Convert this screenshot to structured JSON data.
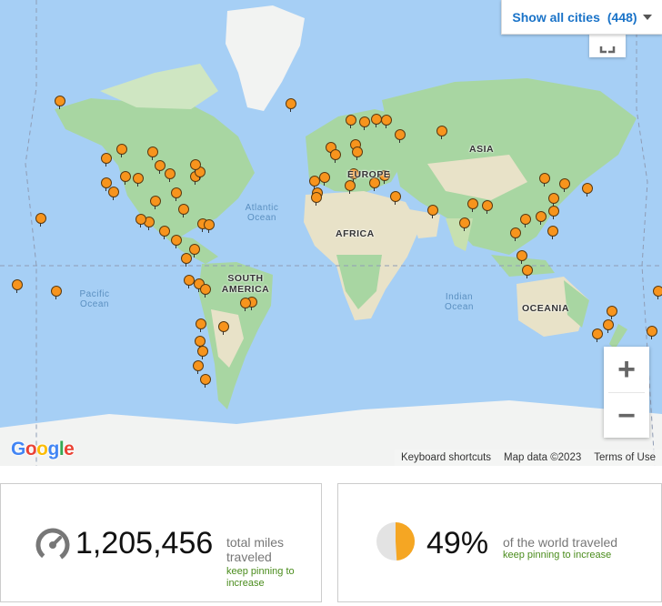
{
  "map": {
    "continent_labels": [
      "ASIA",
      "AFRICA",
      "SOUTH AMERICA",
      "EUROPE",
      "OCEANIA"
    ],
    "ocean_labels": [
      "Atlantic Ocean",
      "Pacific Ocean",
      "Indian Ocean"
    ],
    "show_all_label": "Show all cities",
    "city_count": "(448)",
    "zoom_in": "+",
    "zoom_out": "−",
    "google_logo": "Google",
    "attribution": {
      "keyboard": "Keyboard shortcuts",
      "map_data": "Map data ©2023",
      "terms": "Terms of Use"
    },
    "pin_color": "#f7941d",
    "pin_clusters": [
      {
        "region": "Alaska",
        "lat": 64.8,
        "lng": -147.7
      },
      {
        "region": "Pacific Northwest",
        "lat": 47.6,
        "lng": -122.3
      },
      {
        "region": "California",
        "lat": 37.8,
        "lng": -122.4
      },
      {
        "region": "California",
        "lat": 34.0,
        "lng": -118.2
      },
      {
        "region": "Mountain West",
        "lat": 40.8,
        "lng": -111.9
      },
      {
        "region": "Mountain West",
        "lat": 39.7,
        "lng": -105.0
      },
      {
        "region": "Canada",
        "lat": 51.0,
        "lng": -114.1
      },
      {
        "region": "Canada",
        "lat": 49.9,
        "lng": -97.1
      },
      {
        "region": "Midwest",
        "lat": 41.9,
        "lng": -87.6
      },
      {
        "region": "Midwest",
        "lat": 44.9,
        "lng": -93.3
      },
      {
        "region": "Northeast",
        "lat": 40.7,
        "lng": -74.0
      },
      {
        "region": "Northeast",
        "lat": 42.4,
        "lng": -71.1
      },
      {
        "region": "Canada",
        "lat": 45.5,
        "lng": -73.6
      },
      {
        "region": "South",
        "lat": 33.7,
        "lng": -84.4
      },
      {
        "region": "South",
        "lat": 29.8,
        "lng": -95.4
      },
      {
        "region": "South",
        "lat": 25.8,
        "lng": -80.2
      },
      {
        "region": "Mexico",
        "lat": 19.4,
        "lng": -99.1
      },
      {
        "region": "Mexico",
        "lat": 20.7,
        "lng": -103.3
      },
      {
        "region": "Central America",
        "lat": 14.6,
        "lng": -90.5
      },
      {
        "region": "Central America",
        "lat": 9.9,
        "lng": -84.1
      },
      {
        "region": "Caribbean",
        "lat": 18.5,
        "lng": -69.9
      },
      {
        "region": "Caribbean",
        "lat": 18.2,
        "lng": -66.5
      },
      {
        "region": "Hawaii",
        "lat": 21.3,
        "lng": -157.8
      },
      {
        "region": "South America",
        "lat": 4.7,
        "lng": -74.1
      },
      {
        "region": "South America",
        "lat": -0.2,
        "lng": -78.5
      },
      {
        "region": "South America",
        "lat": -12.0,
        "lng": -77.0
      },
      {
        "region": "South America",
        "lat": -13.5,
        "lng": -72.0
      },
      {
        "region": "South America",
        "lat": -16.5,
        "lng": -68.1
      },
      {
        "region": "South America",
        "lat": -22.9,
        "lng": -43.2
      },
      {
        "region": "South America",
        "lat": -23.5,
        "lng": -46.6
      },
      {
        "region": "South America",
        "lat": -33.4,
        "lng": -70.6
      },
      {
        "region": "South America",
        "lat": -34.6,
        "lng": -58.4
      },
      {
        "region": "Patagonia",
        "lat": -41.1,
        "lng": -71.3
      },
      {
        "region": "Patagonia",
        "lat": -45.0,
        "lng": -70.0
      },
      {
        "region": "Patagonia",
        "lat": -50.3,
        "lng": -72.3
      },
      {
        "region": "Patagonia",
        "lat": -54.8,
        "lng": -68.3
      },
      {
        "region": "Iceland",
        "lat": 64.1,
        "lng": -21.9
      },
      {
        "region": "Scandinavia",
        "lat": 59.9,
        "lng": 10.8
      },
      {
        "region": "Scandinavia",
        "lat": 59.3,
        "lng": 18.1
      },
      {
        "region": "Scandinavia",
        "lat": 60.2,
        "lng": 24.9
      },
      {
        "region": "Europe",
        "lat": 51.5,
        "lng": -0.1
      },
      {
        "region": "Europe",
        "lat": 48.9,
        "lng": 2.4
      },
      {
        "region": "Europe",
        "lat": 52.5,
        "lng": 13.4
      },
      {
        "region": "Europe",
        "lat": 50.1,
        "lng": 14.4
      },
      {
        "region": "Europe",
        "lat": 41.9,
        "lng": 12.5
      },
      {
        "region": "Europe",
        "lat": 40.4,
        "lng": -3.7
      },
      {
        "region": "Europe",
        "lat": 38.7,
        "lng": -9.1
      },
      {
        "region": "Europe",
        "lat": 37.98,
        "lng": 23.7
      },
      {
        "region": "Europe",
        "lat": 41.0,
        "lng": 29.0
      },
      {
        "region": "Russia",
        "lat": 55.8,
        "lng": 37.6
      },
      {
        "region": "Russia",
        "lat": 59.9,
        "lng": 30.3
      },
      {
        "region": "Russia",
        "lat": 56.8,
        "lng": 60.6
      },
      {
        "region": "North Africa",
        "lat": 33.6,
        "lng": -7.6
      },
      {
        "region": "North Africa",
        "lat": 31.6,
        "lng": -8.0
      },
      {
        "region": "North Africa",
        "lat": 36.8,
        "lng": 10.2
      },
      {
        "region": "Middle East",
        "lat": 31.8,
        "lng": 35.2
      },
      {
        "region": "Middle East",
        "lat": 25.3,
        "lng": 55.3
      },
      {
        "region": "South Asia",
        "lat": 28.6,
        "lng": 77.2
      },
      {
        "region": "South Asia",
        "lat": 19.1,
        "lng": 72.9
      },
      {
        "region": "South Asia",
        "lat": 27.7,
        "lng": 85.3
      },
      {
        "region": "Southeast Asia",
        "lat": 13.8,
        "lng": 100.5
      },
      {
        "region": "Southeast Asia",
        "lat": 21.0,
        "lng": 105.8
      },
      {
        "region": "Southeast Asia",
        "lat": 1.35,
        "lng": 103.8
      },
      {
        "region": "Southeast Asia",
        "lat": -6.2,
        "lng": 106.8
      },
      {
        "region": "Southeast Asia",
        "lat": 14.6,
        "lng": 121.0
      },
      {
        "region": "East Asia",
        "lat": 39.9,
        "lng": 116.4
      },
      {
        "region": "East Asia",
        "lat": 31.2,
        "lng": 121.5
      },
      {
        "region": "East Asia",
        "lat": 22.3,
        "lng": 114.2
      },
      {
        "region": "East Asia",
        "lat": 37.6,
        "lng": 127.0
      },
      {
        "region": "East Asia",
        "lat": 35.7,
        "lng": 139.7
      },
      {
        "region": "East Asia",
        "lat": 25.0,
        "lng": 121.5
      },
      {
        "region": "Australia",
        "lat": -33.9,
        "lng": 151.2
      },
      {
        "region": "Australia",
        "lat": -37.8,
        "lng": 145.0
      },
      {
        "region": "Australia",
        "lat": -27.5,
        "lng": 153.0
      },
      {
        "region": "New Zealand",
        "lat": -36.8,
        "lng": 174.8
      },
      {
        "region": "Pacific",
        "lat": -17.7,
        "lng": 178.0
      },
      {
        "region": "Pacific",
        "lat": -17.5,
        "lng": -149.6
      },
      {
        "region": "Pacific",
        "lat": -14.3,
        "lng": -170.7
      }
    ]
  },
  "stats": {
    "miles_value": "1,205,456",
    "miles_label": "total miles traveled",
    "miles_hint": "keep pinning to increase",
    "world_value": "49%",
    "world_fraction": 0.49,
    "world_label": "of the world traveled",
    "world_hint": "keep pinning to increase",
    "accent_color": "#f5a623"
  }
}
